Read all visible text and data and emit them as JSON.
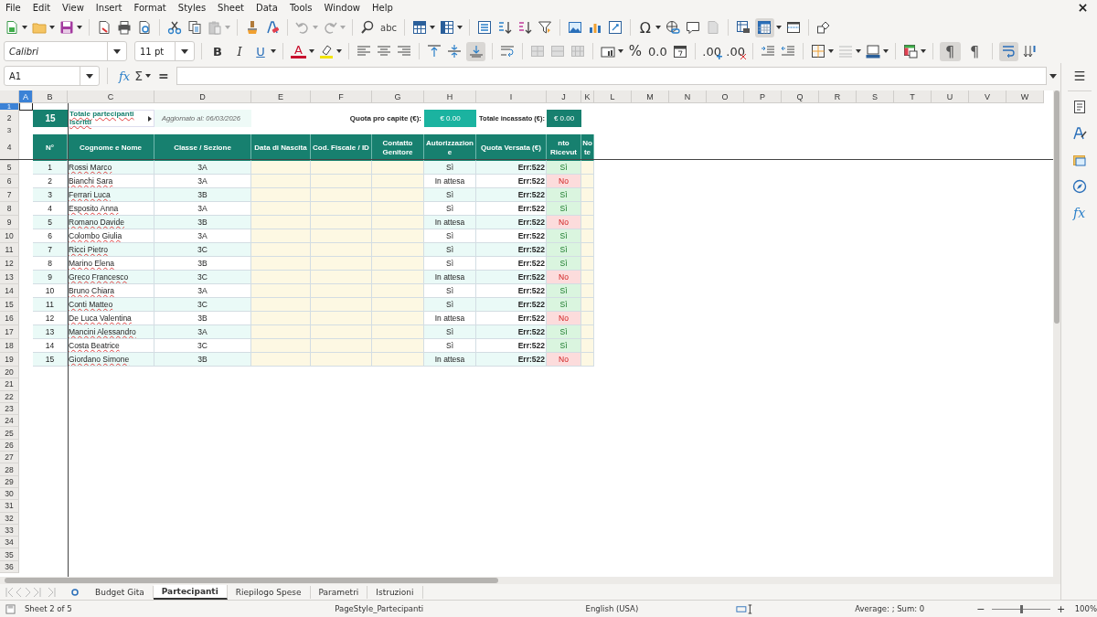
{
  "menu": [
    "File",
    "Edit",
    "View",
    "Insert",
    "Format",
    "Styles",
    "Sheet",
    "Data",
    "Tools",
    "Window",
    "Help"
  ],
  "toolbar_glyphs": {
    "spelling": "abc",
    "special_character": "Ω",
    "bold": "B",
    "italic": "I",
    "underline": "U",
    "font_color": "A",
    "percent": "%",
    "number": "0.0",
    "add_decimal": ".00",
    "delete_decimal": ".00",
    "paragraph_ltr": "¶",
    "paragraph_rtl": "¶"
  },
  "toolbar_states": {
    "freeze_rows_columns": true,
    "align_bottom": true,
    "paragraph_ltr": true,
    "wrap_text": true
  },
  "font_name": "Calibri",
  "font_size": "11 pt",
  "formula_bar": {
    "name_box": "A1",
    "function_wizard": "fx",
    "sum": "Σ",
    "formula": "="
  },
  "sidebar": {
    "functions": "fx"
  },
  "sheet": {
    "columns": [
      {
        "label": "A",
        "selected": true
      },
      {
        "label": "B",
        "selected": false
      },
      {
        "label": "C",
        "selected": false
      },
      {
        "label": "D",
        "selected": false
      },
      {
        "label": "E",
        "selected": false
      },
      {
        "label": "F",
        "selected": false
      },
      {
        "label": "G",
        "selected": false
      },
      {
        "label": "H",
        "selected": false
      },
      {
        "label": "I",
        "selected": false
      },
      {
        "label": "J",
        "selected": false
      },
      {
        "label": "K",
        "selected": false
      },
      {
        "label": "L",
        "selected": false
      },
      {
        "label": "M",
        "selected": false
      },
      {
        "label": "N",
        "selected": false
      },
      {
        "label": "O",
        "selected": false
      },
      {
        "label": "P",
        "selected": false
      },
      {
        "label": "Q",
        "selected": false
      },
      {
        "label": "R",
        "selected": false
      },
      {
        "label": "S",
        "selected": false
      },
      {
        "label": "T",
        "selected": false
      },
      {
        "label": "U",
        "selected": false
      },
      {
        "label": "V",
        "selected": false
      },
      {
        "label": "W",
        "selected": false
      }
    ],
    "rows": [
      {
        "label": "1",
        "selected": true
      },
      {
        "label": "2",
        "selected": false
      },
      {
        "label": "3",
        "selected": false
      },
      {
        "label": "4",
        "selected": false
      },
      {
        "label": "5",
        "selected": false
      },
      {
        "label": "6",
        "selected": false
      },
      {
        "label": "7",
        "selected": false
      },
      {
        "label": "8",
        "selected": false
      },
      {
        "label": "9",
        "selected": false
      },
      {
        "label": "10",
        "selected": false
      },
      {
        "label": "11",
        "selected": false
      },
      {
        "label": "12",
        "selected": false
      },
      {
        "label": "13",
        "selected": false
      },
      {
        "label": "14",
        "selected": false
      },
      {
        "label": "15",
        "selected": false
      },
      {
        "label": "16",
        "selected": false
      },
      {
        "label": "17",
        "selected": false
      },
      {
        "label": "18",
        "selected": false
      },
      {
        "label": "19",
        "selected": false
      },
      {
        "label": "20",
        "selected": false
      },
      {
        "label": "21",
        "selected": false
      },
      {
        "label": "22",
        "selected": false
      },
      {
        "label": "23",
        "selected": false
      },
      {
        "label": "24",
        "selected": false
      },
      {
        "label": "25",
        "selected": false
      },
      {
        "label": "26",
        "selected": false
      },
      {
        "label": "27",
        "selected": false
      },
      {
        "label": "28",
        "selected": false
      },
      {
        "label": "29",
        "selected": false
      },
      {
        "label": "30",
        "selected": false
      },
      {
        "label": "31",
        "selected": false
      },
      {
        "label": "32",
        "selected": false
      },
      {
        "label": "33",
        "selected": false
      },
      {
        "label": "34",
        "selected": false
      },
      {
        "label": "35",
        "selected": false
      },
      {
        "label": "36",
        "selected": false
      }
    ]
  },
  "summary": {
    "count": "15",
    "count_label": "Totale partecipanti iscritti",
    "updated": "Aggiornato al: 06/03/2026",
    "quota_label": "Quota pro capite (€):",
    "quota_value": "€ 0.00",
    "total_label": "Totale incassato (€):",
    "total_value": "€ 0.00"
  },
  "table": {
    "headers": [
      "N°",
      "Cognome e Nome",
      "Classe / Sezione",
      "Data di Nascita",
      "Cod. Fiscale / ID",
      "Contatto Genitore",
      "Autorizzazione",
      "Quota Versata (€)",
      "nto Ricevut",
      "Note"
    ],
    "rows": [
      {
        "n": "1",
        "name": "Rossi Marco",
        "class": "3A",
        "authorization": "Sì",
        "quota": "Err:522",
        "received": "Sì",
        "paid": true
      },
      {
        "n": "2",
        "name": "Bianchi Sara",
        "class": "3A",
        "authorization": "In attesa",
        "quota": "Err:522",
        "received": "No",
        "paid": false
      },
      {
        "n": "3",
        "name": "Ferrari Luca",
        "class": "3B",
        "authorization": "Sì",
        "quota": "Err:522",
        "received": "Sì",
        "paid": true
      },
      {
        "n": "4",
        "name": "Esposito Anna",
        "class": "3A",
        "authorization": "Sì",
        "quota": "Err:522",
        "received": "Sì",
        "paid": true
      },
      {
        "n": "5",
        "name": "Romano Davide",
        "class": "3B",
        "authorization": "In attesa",
        "quota": "Err:522",
        "received": "No",
        "paid": false
      },
      {
        "n": "6",
        "name": "Colombo Giulia",
        "class": "3A",
        "authorization": "Sì",
        "quota": "Err:522",
        "received": "Sì",
        "paid": true
      },
      {
        "n": "7",
        "name": "Ricci Pietro",
        "class": "3C",
        "authorization": "Sì",
        "quota": "Err:522",
        "received": "Sì",
        "paid": true
      },
      {
        "n": "8",
        "name": "Marino Elena",
        "class": "3B",
        "authorization": "Sì",
        "quota": "Err:522",
        "received": "Sì",
        "paid": true
      },
      {
        "n": "9",
        "name": "Greco Francesco",
        "class": "3C",
        "authorization": "In attesa",
        "quota": "Err:522",
        "received": "No",
        "paid": false
      },
      {
        "n": "10",
        "name": "Bruno Chiara",
        "class": "3A",
        "authorization": "Sì",
        "quota": "Err:522",
        "received": "Sì",
        "paid": true
      },
      {
        "n": "11",
        "name": "Conti Matteo",
        "class": "3C",
        "authorization": "Sì",
        "quota": "Err:522",
        "received": "Sì",
        "paid": true
      },
      {
        "n": "12",
        "name": "De Luca Valentina",
        "class": "3B",
        "authorization": "In attesa",
        "quota": "Err:522",
        "received": "No",
        "paid": false
      },
      {
        "n": "13",
        "name": "Mancini Alessandro",
        "class": "3A",
        "authorization": "Sì",
        "quota": "Err:522",
        "received": "Sì",
        "paid": true
      },
      {
        "n": "14",
        "name": "Costa Beatrice",
        "class": "3C",
        "authorization": "Sì",
        "quota": "Err:522",
        "received": "Sì",
        "paid": true
      },
      {
        "n": "15",
        "name": "Giordano Simone",
        "class": "3B",
        "authorization": "In attesa",
        "quota": "Err:522",
        "received": "No",
        "paid": false
      }
    ]
  },
  "sheet_tabs": [
    {
      "label": "Budget Gita",
      "selected": false
    },
    {
      "label": "Partecipanti",
      "selected": true
    },
    {
      "label": "Riepilogo Spese",
      "selected": false
    },
    {
      "label": "Parametri",
      "selected": false
    },
    {
      "label": "Istruzioni",
      "selected": false
    }
  ],
  "status_bar": {
    "sheet": "Sheet 2 of 5",
    "page_style": "PageStyle_Partecipanti",
    "language": "English (USA)",
    "selection": "Average: ; Sum: 0",
    "zoom_out": "−",
    "zoom_in": "+",
    "zoom": "100%",
    "level": 0.5
  }
}
